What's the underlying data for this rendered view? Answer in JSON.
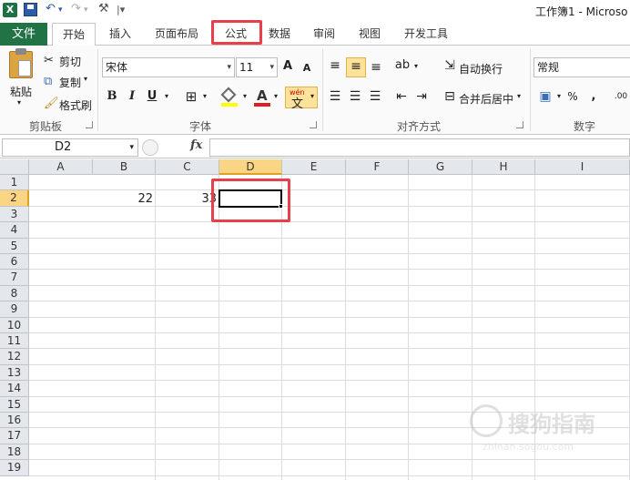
{
  "titlebar": {
    "app_icon": "X",
    "title": "工作簿1 - Microso",
    "qat_symbols": [
      "↶",
      "▾",
      "↷",
      "▾",
      "⚒",
      "|▾"
    ]
  },
  "tabs": {
    "file": "文件",
    "items": [
      "开始",
      "插入",
      "页面布局",
      "公式",
      "数据",
      "审阅",
      "视图",
      "开发工具"
    ]
  },
  "ribbon": {
    "clipboard": {
      "paste": "粘贴",
      "cut": "剪切",
      "copy": "复制",
      "format_painter": "格式刷",
      "label": "剪贴板"
    },
    "font": {
      "name": "宋体",
      "size": "11",
      "grow": "A",
      "shrink": "A",
      "bold": "B",
      "italic": "I",
      "underline": "U",
      "label": "字体",
      "phonetic": "文"
    },
    "alignment": {
      "wrap": "自动换行",
      "merge": "合并后居中",
      "label": "对齐方式"
    },
    "number": {
      "format": "常规",
      "percent": "%",
      "comma": ",",
      "label": "数字"
    }
  },
  "formula_bar": {
    "name_box": "D2",
    "fx": "fx",
    "content": ""
  },
  "sheet": {
    "columns": [
      "A",
      "B",
      "C",
      "D",
      "E",
      "F",
      "G",
      "H",
      "I"
    ],
    "selected_column": "D",
    "rows": [
      "1",
      "2",
      "3",
      "4",
      "5",
      "6",
      "7",
      "8",
      "9",
      "10",
      "11",
      "12",
      "13",
      "14",
      "15",
      "16",
      "17",
      "18",
      "19"
    ],
    "selected_row": "2",
    "cells": {
      "B2": "22",
      "C2": "33"
    }
  },
  "watermark": {
    "text": "搜狗指南",
    "url": "zhinan.sogou.com"
  },
  "colors": {
    "file_tab": "#217346",
    "highlight": "#e8404a",
    "header_selected": "#fad583"
  }
}
